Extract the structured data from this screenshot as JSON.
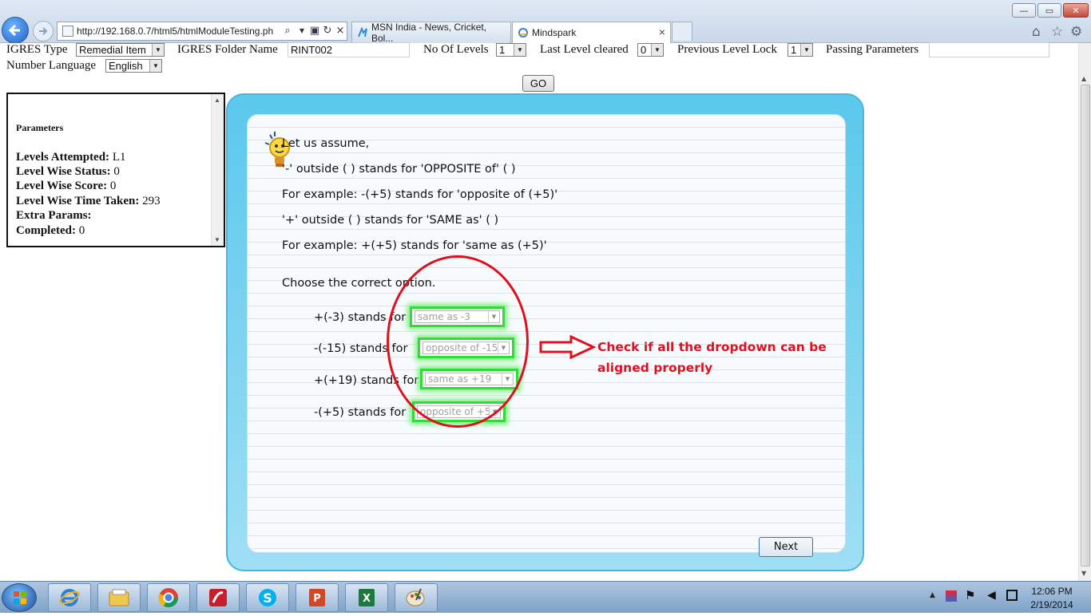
{
  "browser": {
    "address": "http://192.168.0.7/html5/htmlModuleTesting.ph",
    "tabs": [
      {
        "label": "MSN India - News, Cricket, Bol..."
      },
      {
        "label": "Mindspark",
        "close": "×"
      }
    ],
    "address_close": "×"
  },
  "form": {
    "igres_type_label": "IGRES Type",
    "igres_type_value": "Remedial Item",
    "folder_label": "IGRES Folder Name",
    "folder_value": "RINT002",
    "levels_label": "No Of Levels",
    "levels_value": "1",
    "last_cleared_label": "Last Level cleared",
    "last_cleared_value": "0",
    "prev_lock_label": "Previous Level Lock",
    "prev_lock_value": "1",
    "passing_label": "Passing Parameters",
    "passing_value": "",
    "language_label": "Number Language",
    "language_value": "English",
    "go_label": "GO"
  },
  "params": {
    "title": "Parameters",
    "rows": [
      {
        "label": "Levels Attempted:",
        "value": "L1"
      },
      {
        "label": "Level Wise Status:",
        "value": "0"
      },
      {
        "label": "Level Wise Score:",
        "value": "0"
      },
      {
        "label": "Level Wise Time Taken:",
        "value": "293"
      },
      {
        "label": "Extra Params:",
        "value": ""
      },
      {
        "label": "Completed:",
        "value": "0"
      }
    ]
  },
  "activity": {
    "lines": [
      "Let us assume,",
      "'-' outside ( ) stands for 'OPPOSITE of' ( )",
      "For example: -(+5) stands for 'opposite of (+5)'",
      "'+' outside ( ) stands for 'SAME as' ( )",
      "For example: +(+5) stands for 'same as (+5)'"
    ],
    "prompt": "Choose the correct option.",
    "questions": [
      {
        "text": "+(-3) stands for",
        "selected": "same as -3"
      },
      {
        "text": "-(-15) stands for",
        "selected": "opposite of -15"
      },
      {
        "text": "+(+19) stands for",
        "selected": "same as +19"
      },
      {
        "text": "-(+5) stands for",
        "selected": "opposite of +5"
      }
    ],
    "next_label": "Next"
  },
  "annotation": {
    "text": "Check if all the dropdown can be\naligned properly",
    "color": "#e0101f"
  },
  "taskbar": {
    "apps": [
      "ie-icon",
      "explorer-icon",
      "chrome-icon",
      "app-icon",
      "skype-icon",
      "powerpoint-icon",
      "excel-icon",
      "paint-icon"
    ],
    "time": "12:06 PM",
    "date": "2/19/2014"
  },
  "colors": {
    "frame_blue": "#5bc8ec",
    "dropdown_highlight": "#2fdc3a"
  }
}
